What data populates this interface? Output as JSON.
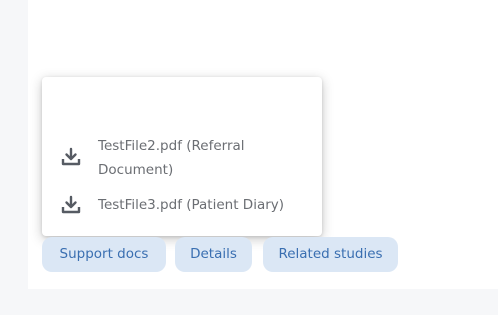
{
  "dropdown": {
    "items": [
      {
        "label": "TestFile2.pdf (Referral Document)",
        "icon": "download-icon"
      },
      {
        "label": "TestFile3.pdf (Patient Diary)",
        "icon": "download-icon"
      }
    ]
  },
  "tabs": [
    {
      "label": "Support docs"
    },
    {
      "label": "Details"
    },
    {
      "label": "Related studies"
    }
  ],
  "colors": {
    "chip_bg": "#dbe7f5",
    "chip_text": "#3a6fb1",
    "item_text": "#6b6e73",
    "icon": "#565b63"
  }
}
